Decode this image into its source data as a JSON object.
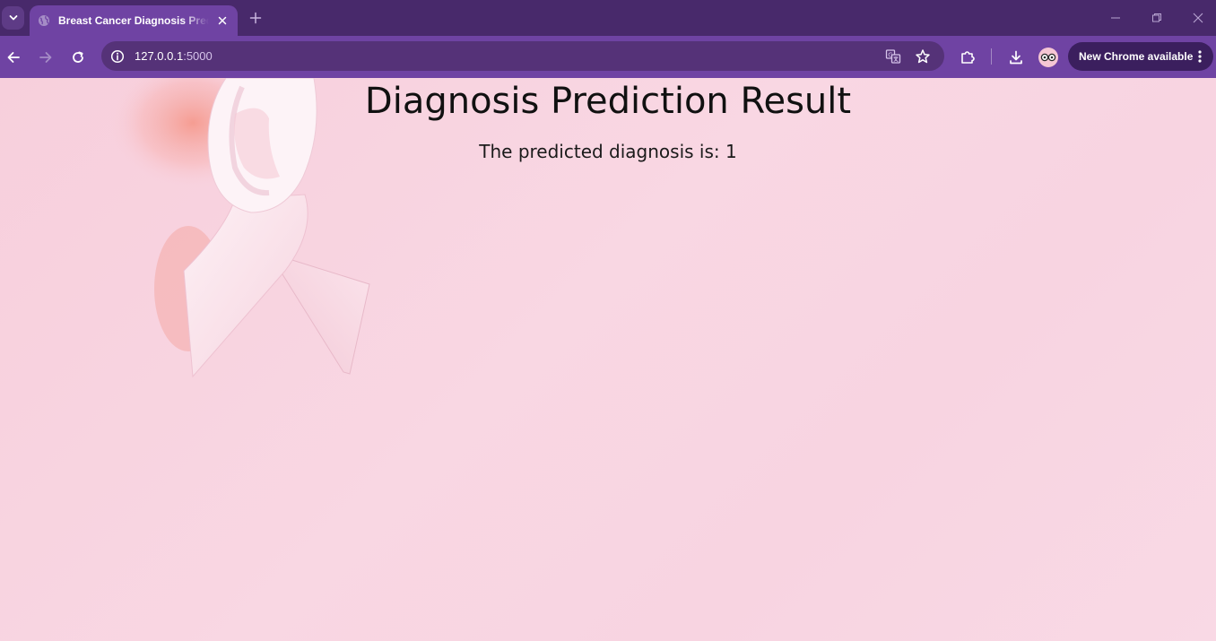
{
  "window": {
    "tab": {
      "title": "Breast Cancer Diagnosis Prediction"
    },
    "new_tab_icon": "plus-icon",
    "controls": [
      "minimize-icon",
      "restore-icon",
      "close-icon"
    ]
  },
  "toolbar": {
    "url_host": "127.0.0.1",
    "url_port": ":5000",
    "update_chip": "New Chrome available"
  },
  "page": {
    "title": "Diagnosis Prediction Result",
    "result_label": "The predicted diagnosis is: ",
    "result_value": "1"
  },
  "colors": {
    "tabstrip": "#48296b",
    "toolbar": "#6f43a3",
    "omnibox": "#553278",
    "page_bg": "#f8d3e0",
    "ribbon": "#fbe8ef"
  }
}
